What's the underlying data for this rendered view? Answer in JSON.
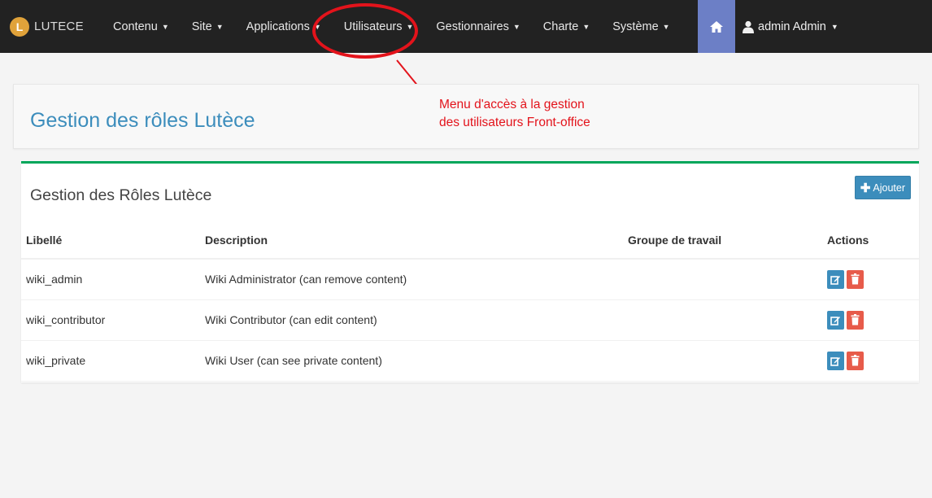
{
  "navbar": {
    "brand_letter": "L",
    "brand_text": "LUTECE",
    "items": [
      {
        "label": "Contenu"
      },
      {
        "label": "Site"
      },
      {
        "label": "Applications"
      },
      {
        "label": "Utilisateurs"
      },
      {
        "label": "Gestionnaires"
      },
      {
        "label": "Charte"
      },
      {
        "label": "Système"
      }
    ],
    "user_label": "admin Admin"
  },
  "page": {
    "title": "Gestion des rôles Lutèce"
  },
  "annotation": {
    "line1": "Menu d'accès à la gestion",
    "line2": "des utilisateurs Front-office"
  },
  "roles_box": {
    "title": "Gestion des Rôles Lutèce",
    "add_label": "Ajouter",
    "columns": {
      "label": "Libellé",
      "description": "Description",
      "group": "Groupe de travail",
      "actions": "Actions"
    },
    "rows": [
      {
        "label": "wiki_admin",
        "description": "Wiki Administrator (can remove content)",
        "group": ""
      },
      {
        "label": "wiki_contributor",
        "description": "Wiki Contributor (can edit content)",
        "group": ""
      },
      {
        "label": "wiki_private",
        "description": "Wiki User (can see private content)",
        "group": ""
      }
    ]
  },
  "colors": {
    "navbar_bg": "#222222",
    "home_bg": "#6c7fc6",
    "title_blue": "#3c8dbc",
    "annotation_red": "#e3131b",
    "box_border_green": "#00a65a",
    "edit_blue": "#3c8dbc",
    "delete_red": "#e75b4a"
  },
  "icons": {
    "home": "home-icon",
    "user": "user-icon",
    "add": "plus-icon",
    "edit": "edit-icon",
    "delete": "trash-icon"
  }
}
